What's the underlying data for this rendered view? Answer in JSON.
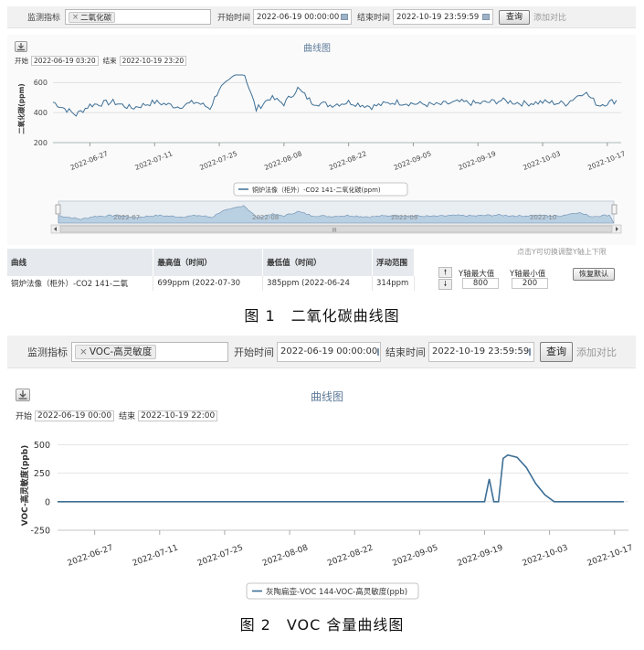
{
  "fig1": {
    "toolbar": {
      "monitor_label": "监测指标",
      "tag": "二氧化碳",
      "start_label": "开始时间",
      "start_value": "2022-06-19 00:00:00",
      "end_label": "结束时间",
      "end_value": "2022-10-19 23:59:59",
      "query_button": "查询",
      "compare_link": "添加对比"
    },
    "chart_title": "曲线图",
    "range": {
      "start_label": "开始",
      "start_value": "2022-06-19 03:20",
      "end_label": "结束",
      "end_value": "2022-10-19 23:20"
    },
    "ylabel": "二氧化碳(ppm)",
    "yticks": [
      "600",
      "400",
      "200"
    ],
    "xticks": [
      "2022-06-27",
      "2022-07-11",
      "2022-07-25",
      "2022-08-08",
      "2022-08-22",
      "2022-09-05",
      "2022-09-19",
      "2022-10-03",
      "2022-10-17"
    ],
    "legend": "铜炉法像（柜外）-CO2 141-二氧化碳(ppm)",
    "navigator_ticks": [
      "2022-07",
      "2022-08",
      "2022-09",
      "2022-10"
    ],
    "scroll_mark": "III",
    "hint": "点击Y可切换调整Y轴上下限",
    "table": {
      "headers": [
        "曲线",
        "最高值（时间）",
        "最低值（时间）",
        "浮动范围"
      ],
      "row": [
        "铜炉法像（柜外）-CO2 141-二氧",
        "699ppm (2022-07-30",
        "385ppm (2022-06-24",
        "314ppm"
      ]
    },
    "y_controls": {
      "max_label": "Y轴最大值",
      "min_label": "Y轴最小值",
      "max_value": "800",
      "min_value": "200",
      "reset_button": "恢复默认",
      "up": "🠕",
      "down": "🠗"
    },
    "caption": "图 1　二氧化碳曲线图"
  },
  "fig2": {
    "toolbar": {
      "monitor_label": "监测指标",
      "tag": "VOC-高灵敏度",
      "start_label": "开始时间",
      "start_value": "2022-06-19 00:00:00",
      "end_label": "结束时间",
      "end_value": "2022-10-19 23:59:59",
      "query_button": "查询",
      "compare_link": "添加对比"
    },
    "chart_title": "曲线图",
    "range": {
      "start_label": "开始",
      "start_value": "2022-06-19 00:00",
      "end_label": "结束",
      "end_value": "2022-10-19 22:00"
    },
    "ylabel": "VOC-高灵敏度(ppb)",
    "yticks": [
      "500",
      "250",
      "0",
      "-250"
    ],
    "xticks": [
      "2022-06-27",
      "2022-07-11",
      "2022-07-25",
      "2022-08-08",
      "2022-08-22",
      "2022-09-05",
      "2022-09-19",
      "2022-10-03",
      "2022-10-17"
    ],
    "legend": "灰陶扁壶-VOC 144-VOC-高灵敏度(ppb)",
    "caption": "图 2　VOC 含量曲线图"
  },
  "chart_data": [
    {
      "type": "line",
      "ylabel": "二氧化碳(ppm)",
      "ylim": [
        200,
        650
      ],
      "series": [
        {
          "name": "铜炉法像（柜外）-CO2 141-二氧化碳(ppm)",
          "x": [
            "2022-06-19",
            "2022-06-24",
            "2022-06-27",
            "2022-07-02",
            "2022-07-06",
            "2022-07-11",
            "2022-07-16",
            "2022-07-20",
            "2022-07-23",
            "2022-07-25",
            "2022-07-27",
            "2022-07-30",
            "2022-08-02",
            "2022-08-05",
            "2022-08-08",
            "2022-08-11",
            "2022-08-14",
            "2022-08-18",
            "2022-08-22",
            "2022-08-27",
            "2022-09-01",
            "2022-09-05",
            "2022-09-10",
            "2022-09-15",
            "2022-09-19",
            "2022-09-24",
            "2022-09-29",
            "2022-10-03",
            "2022-10-08",
            "2022-10-12",
            "2022-10-15",
            "2022-10-19"
          ],
          "values": [
            470,
            385,
            450,
            470,
            430,
            470,
            440,
            470,
            430,
            560,
            600,
            699,
            420,
            500,
            460,
            560,
            470,
            450,
            470,
            440,
            470,
            460,
            450,
            470,
            460,
            480,
            460,
            470,
            460,
            540,
            450,
            480
          ]
        }
      ]
    },
    {
      "type": "line",
      "ylabel": "VOC-高灵敏度(ppb)",
      "ylim": [
        -250,
        600
      ],
      "series": [
        {
          "name": "灰陶扁壶-VOC 144-VOC-高灵敏度(ppb)",
          "x": [
            "2022-06-19",
            "2022-09-19",
            "2022-09-20",
            "2022-09-21",
            "2022-09-22",
            "2022-09-23",
            "2022-09-24",
            "2022-09-26",
            "2022-09-28",
            "2022-09-30",
            "2022-10-02",
            "2022-10-04",
            "2022-10-05",
            "2022-10-19"
          ],
          "values": [
            0,
            0,
            200,
            0,
            0,
            380,
            410,
            390,
            300,
            160,
            60,
            0,
            0,
            0
          ]
        }
      ]
    }
  ]
}
